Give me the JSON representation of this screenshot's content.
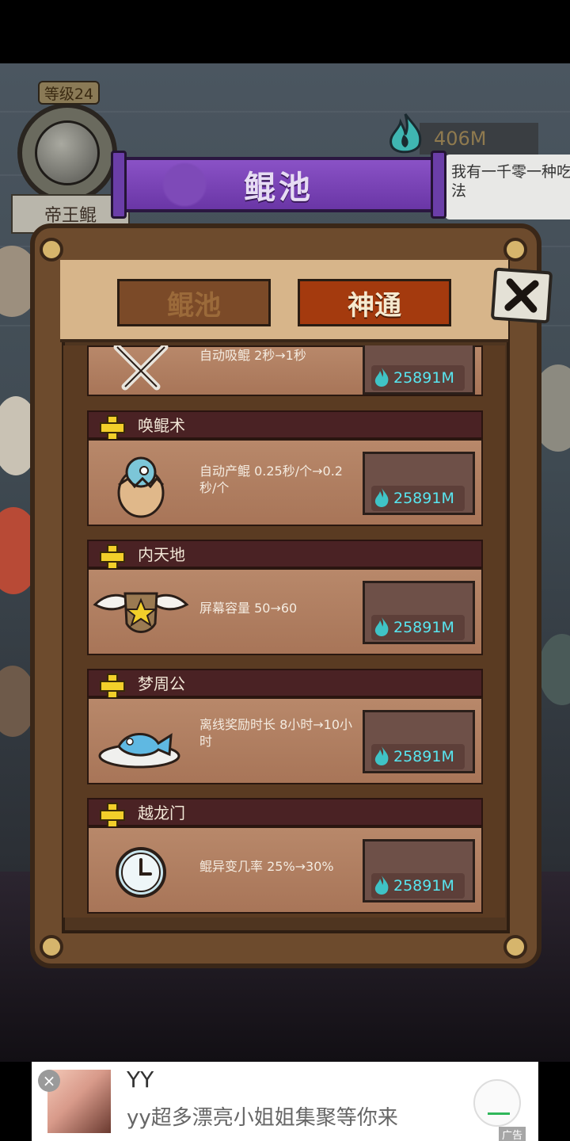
{
  "hud": {
    "level_label": "等级24",
    "player_name": "帝王鲲",
    "currency_amount": "406M",
    "speech_text": "我有一千零一种吃法"
  },
  "dialog": {
    "title": "鲲池",
    "tabs": [
      {
        "label": "鲲池",
        "active": false
      },
      {
        "label": "神通",
        "active": true
      }
    ],
    "close_icon": "close-x-icon",
    "cost_icon": "blue-flame-icon",
    "items": [
      {
        "title": "",
        "desc": "自动吸鲲 2秒→1秒",
        "cost": "25891M",
        "icon": "crossed-swords-icon"
      },
      {
        "title": "唤鲲术",
        "desc": "自动产鲲 0.25秒/个→0.2秒/个",
        "cost": "25891M",
        "icon": "hatching-egg-icon"
      },
      {
        "title": "内天地",
        "desc": "屏幕容量 50→60",
        "cost": "25891M",
        "icon": "winged-shield-icon"
      },
      {
        "title": "梦周公",
        "desc": "离线奖励时长 8小时→10小时",
        "cost": "25891M",
        "icon": "fish-on-plate-icon"
      },
      {
        "title": "越龙门",
        "desc": "鲲异变几率 25%→30%",
        "cost": "25891M",
        "icon": "clock-icon"
      }
    ]
  },
  "ad": {
    "title": "YY",
    "desc": "yy超多漂亮小姐姐集聚等你来",
    "tag": "广告",
    "close": "×"
  },
  "colors": {
    "dialog_wood": "#6d4b2d",
    "active_tab": "#a43a0e",
    "title_purple": "#7a44b8",
    "cost_text": "#58e6f0"
  }
}
